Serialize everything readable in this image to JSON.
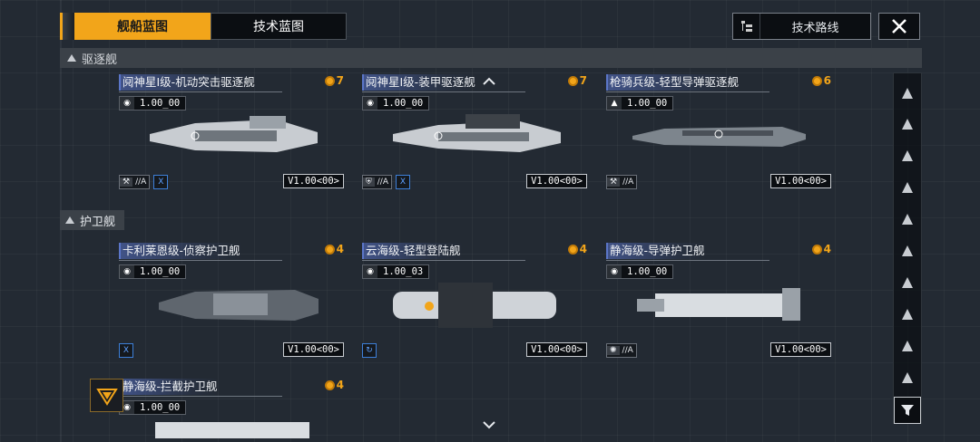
{
  "tabs": [
    {
      "label": "舰船蓝图",
      "active": true
    },
    {
      "label": "技术蓝图",
      "active": false
    }
  ],
  "route_button": {
    "label": "技术路线",
    "icon": "tech-tree-icon"
  },
  "close_icon": "close-icon",
  "sections": {
    "destroyer": "驱逐舰",
    "frigate": "护卫舰"
  },
  "cards": [
    {
      "name": "阋神星I级-机动突击驱逐舰",
      "cost": "7",
      "stat": "1.00_00",
      "version": "V1.00<00>",
      "badges": [
        "//A",
        "X"
      ]
    },
    {
      "name": "阋神星I级-装甲驱逐舰",
      "cost": "7",
      "stat": "1.00_00",
      "version": "V1.00<00>",
      "badges": [
        "//A",
        "X"
      ]
    },
    {
      "name": "枪骑兵级-轻型导弹驱逐舰",
      "cost": "6",
      "stat": "1.00_00",
      "version": "V1.00<00>",
      "badges": [
        "//A"
      ]
    },
    {
      "name": "卡利莱恩级-侦察护卫舰",
      "cost": "4",
      "stat": "1.00_00",
      "version": "V1.00<00>",
      "badges": [
        "X"
      ]
    },
    {
      "name": "云海级-轻型登陆舰",
      "cost": "4",
      "stat": "1.00_03",
      "version": "V1.00<00>",
      "badges": [
        "↻"
      ]
    },
    {
      "name": "静海级-导弹护卫舰",
      "cost": "4",
      "stat": "1.00_00",
      "version": "V1.00<00>",
      "badges": [
        "//A"
      ]
    },
    {
      "name": "静海级-拦截护卫舰",
      "cost": "4",
      "stat": "1.00_00",
      "version": "",
      "badges": []
    }
  ],
  "colors": {
    "accent": "#f2a51a",
    "name_highlight": "#5b76c8",
    "badge_blue": "#3d7fd8"
  }
}
